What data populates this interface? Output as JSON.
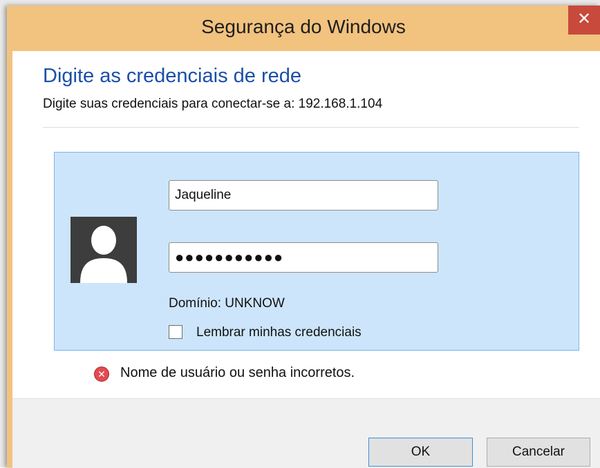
{
  "window": {
    "title": "Segurança do Windows",
    "close_glyph": "✕",
    "close_color": "#c74a3c",
    "titlebar_color": "#f2c27f"
  },
  "dialog": {
    "heading": "Digite as credenciais de rede",
    "subtext": "Digite suas credenciais para conectar-se a: 192.168.1.104",
    "heading_color": "#1b4fa8"
  },
  "credentials": {
    "avatar_icon": "user-silhouette-icon",
    "username_value": "Jaqueline",
    "password_masked": "●●●●●●●●●●●",
    "domain_label": "Domínio: UNKNOW",
    "remember_label": "Lembrar minhas credenciais",
    "remember_checked": false,
    "box_color": "#cce5fb"
  },
  "error": {
    "icon": "error-icon",
    "glyph": "✕",
    "message": "Nome de usuário ou senha incorretos.",
    "color": "#e44a52"
  },
  "buttons": {
    "ok_label": "OK",
    "cancel_label": "Cancelar"
  }
}
